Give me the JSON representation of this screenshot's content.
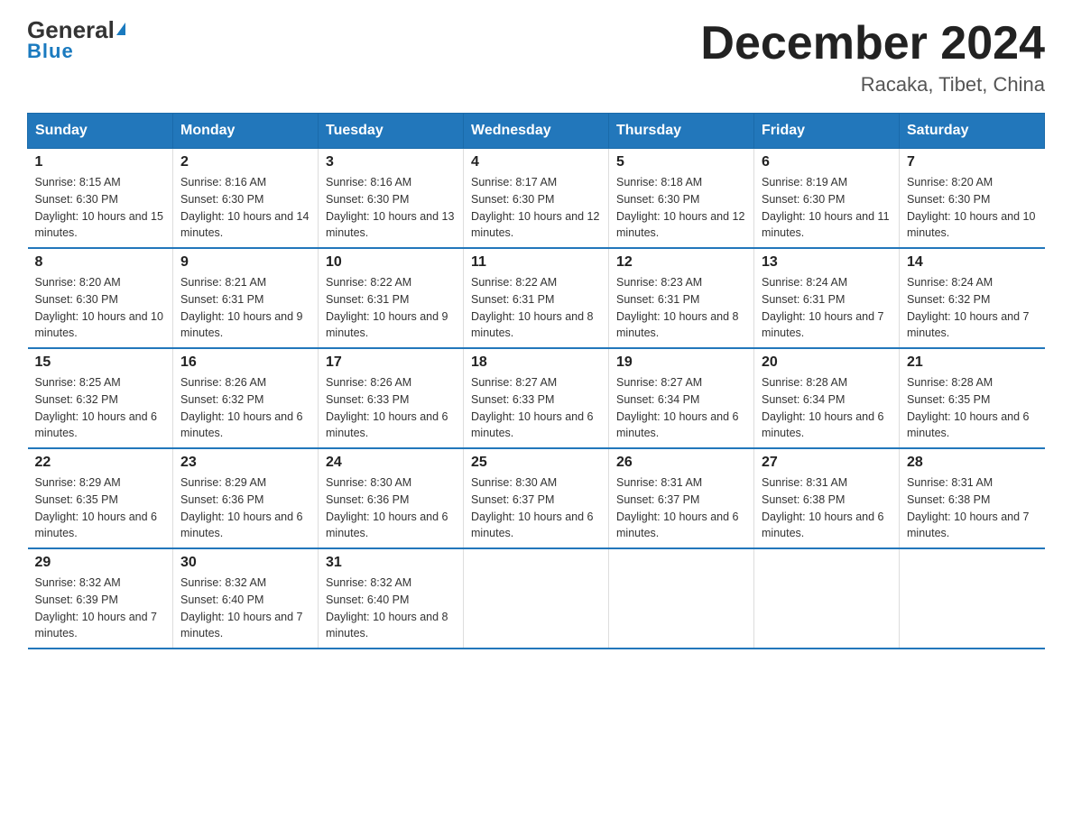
{
  "header": {
    "logo_general": "General",
    "logo_blue": "Blue",
    "month_title": "December 2024",
    "location": "Racaka, Tibet, China"
  },
  "days_of_week": [
    "Sunday",
    "Monday",
    "Tuesday",
    "Wednesday",
    "Thursday",
    "Friday",
    "Saturday"
  ],
  "weeks": [
    [
      {
        "day": "1",
        "sunrise": "8:15 AM",
        "sunset": "6:30 PM",
        "daylight": "10 hours and 15 minutes."
      },
      {
        "day": "2",
        "sunrise": "8:16 AM",
        "sunset": "6:30 PM",
        "daylight": "10 hours and 14 minutes."
      },
      {
        "day": "3",
        "sunrise": "8:16 AM",
        "sunset": "6:30 PM",
        "daylight": "10 hours and 13 minutes."
      },
      {
        "day": "4",
        "sunrise": "8:17 AM",
        "sunset": "6:30 PM",
        "daylight": "10 hours and 12 minutes."
      },
      {
        "day": "5",
        "sunrise": "8:18 AM",
        "sunset": "6:30 PM",
        "daylight": "10 hours and 12 minutes."
      },
      {
        "day": "6",
        "sunrise": "8:19 AM",
        "sunset": "6:30 PM",
        "daylight": "10 hours and 11 minutes."
      },
      {
        "day": "7",
        "sunrise": "8:20 AM",
        "sunset": "6:30 PM",
        "daylight": "10 hours and 10 minutes."
      }
    ],
    [
      {
        "day": "8",
        "sunrise": "8:20 AM",
        "sunset": "6:30 PM",
        "daylight": "10 hours and 10 minutes."
      },
      {
        "day": "9",
        "sunrise": "8:21 AM",
        "sunset": "6:31 PM",
        "daylight": "10 hours and 9 minutes."
      },
      {
        "day": "10",
        "sunrise": "8:22 AM",
        "sunset": "6:31 PM",
        "daylight": "10 hours and 9 minutes."
      },
      {
        "day": "11",
        "sunrise": "8:22 AM",
        "sunset": "6:31 PM",
        "daylight": "10 hours and 8 minutes."
      },
      {
        "day": "12",
        "sunrise": "8:23 AM",
        "sunset": "6:31 PM",
        "daylight": "10 hours and 8 minutes."
      },
      {
        "day": "13",
        "sunrise": "8:24 AM",
        "sunset": "6:31 PM",
        "daylight": "10 hours and 7 minutes."
      },
      {
        "day": "14",
        "sunrise": "8:24 AM",
        "sunset": "6:32 PM",
        "daylight": "10 hours and 7 minutes."
      }
    ],
    [
      {
        "day": "15",
        "sunrise": "8:25 AM",
        "sunset": "6:32 PM",
        "daylight": "10 hours and 6 minutes."
      },
      {
        "day": "16",
        "sunrise": "8:26 AM",
        "sunset": "6:32 PM",
        "daylight": "10 hours and 6 minutes."
      },
      {
        "day": "17",
        "sunrise": "8:26 AM",
        "sunset": "6:33 PM",
        "daylight": "10 hours and 6 minutes."
      },
      {
        "day": "18",
        "sunrise": "8:27 AM",
        "sunset": "6:33 PM",
        "daylight": "10 hours and 6 minutes."
      },
      {
        "day": "19",
        "sunrise": "8:27 AM",
        "sunset": "6:34 PM",
        "daylight": "10 hours and 6 minutes."
      },
      {
        "day": "20",
        "sunrise": "8:28 AM",
        "sunset": "6:34 PM",
        "daylight": "10 hours and 6 minutes."
      },
      {
        "day": "21",
        "sunrise": "8:28 AM",
        "sunset": "6:35 PM",
        "daylight": "10 hours and 6 minutes."
      }
    ],
    [
      {
        "day": "22",
        "sunrise": "8:29 AM",
        "sunset": "6:35 PM",
        "daylight": "10 hours and 6 minutes."
      },
      {
        "day": "23",
        "sunrise": "8:29 AM",
        "sunset": "6:36 PM",
        "daylight": "10 hours and 6 minutes."
      },
      {
        "day": "24",
        "sunrise": "8:30 AM",
        "sunset": "6:36 PM",
        "daylight": "10 hours and 6 minutes."
      },
      {
        "day": "25",
        "sunrise": "8:30 AM",
        "sunset": "6:37 PM",
        "daylight": "10 hours and 6 minutes."
      },
      {
        "day": "26",
        "sunrise": "8:31 AM",
        "sunset": "6:37 PM",
        "daylight": "10 hours and 6 minutes."
      },
      {
        "day": "27",
        "sunrise": "8:31 AM",
        "sunset": "6:38 PM",
        "daylight": "10 hours and 6 minutes."
      },
      {
        "day": "28",
        "sunrise": "8:31 AM",
        "sunset": "6:38 PM",
        "daylight": "10 hours and 7 minutes."
      }
    ],
    [
      {
        "day": "29",
        "sunrise": "8:32 AM",
        "sunset": "6:39 PM",
        "daylight": "10 hours and 7 minutes."
      },
      {
        "day": "30",
        "sunrise": "8:32 AM",
        "sunset": "6:40 PM",
        "daylight": "10 hours and 7 minutes."
      },
      {
        "day": "31",
        "sunrise": "8:32 AM",
        "sunset": "6:40 PM",
        "daylight": "10 hours and 8 minutes."
      },
      null,
      null,
      null,
      null
    ]
  ]
}
